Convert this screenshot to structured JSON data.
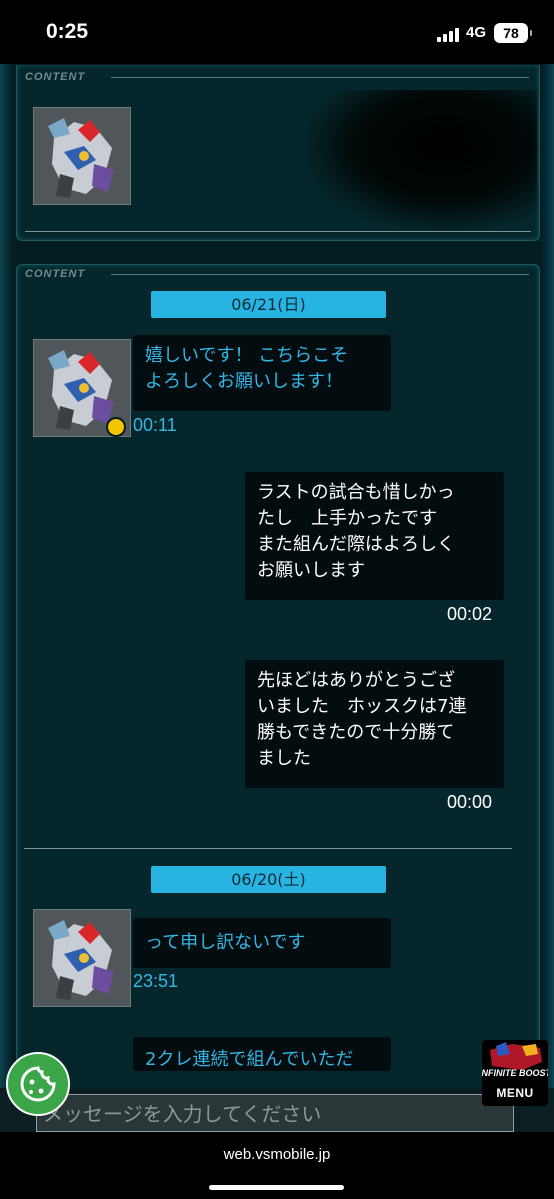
{
  "status": {
    "time": "0:25",
    "network": "4G",
    "battery": "78"
  },
  "panels": {
    "label": "CONTENT"
  },
  "messages": {
    "date1": "06/21(日)",
    "msg1": {
      "text": "嬉しいです！ こちらこそ\nよろしくお願いします！",
      "time": "00:11"
    },
    "msg2": {
      "text": "ラストの試合も惜しかっ\nたし　上手かったです\nまた組んだ際はよろしく\nお願いします",
      "time": "00:02"
    },
    "msg3": {
      "text": "先ほどはありがとうござ\nいました　ホッスクは7連\n勝もできたので十分勝て\nました",
      "time": "00:00"
    },
    "date2": "06/20(土)",
    "msg4": {
      "text": "って申し訳ないです",
      "time": "23:51"
    },
    "msg5": {
      "text": "2クレ連続で組んでいただ"
    }
  },
  "input": {
    "placeholder": "メッセージを入力してください"
  },
  "menu": {
    "label": "MENU",
    "logo_text": "INFINITE BOOST"
  },
  "browser": {
    "url": "web.vsmobile.jp"
  },
  "colors": {
    "accent": "#28b4e3",
    "incoming_text": "#33b7e6",
    "panel_bg": "#05272b",
    "online": "#f4c400",
    "cookie": "#3aa648"
  }
}
